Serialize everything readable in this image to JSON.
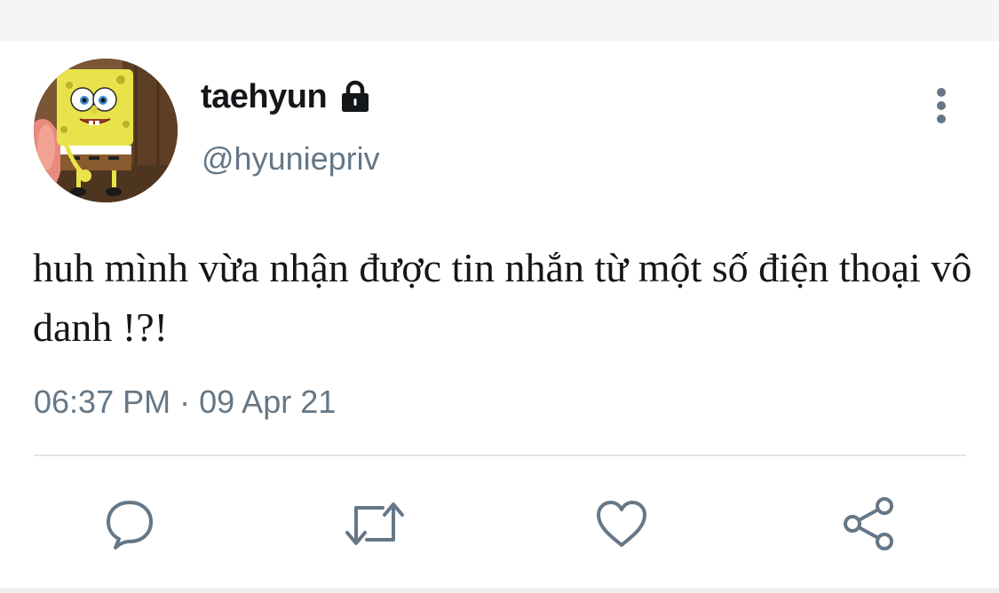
{
  "tweet": {
    "display_name": "taehyun",
    "handle": "@hyuniepriv",
    "text": "huh mình vừa nhận được tin nhắn từ một số điện thoại vô danh !?!",
    "time": "06:37 PM",
    "separator": "·",
    "date": "09 Apr 21",
    "protected_icon": "lock-icon",
    "avatar": "spongebob-avatar"
  },
  "actions": [
    {
      "name": "reply",
      "icon": "comment-bubble-icon"
    },
    {
      "name": "retweet",
      "icon": "retweet-icon"
    },
    {
      "name": "like",
      "icon": "heart-icon"
    },
    {
      "name": "share",
      "icon": "share-icon"
    }
  ],
  "colors": {
    "text_primary": "#14171a",
    "text_secondary": "#657786",
    "divider": "#e1e8ed",
    "background": "#ffffff"
  }
}
